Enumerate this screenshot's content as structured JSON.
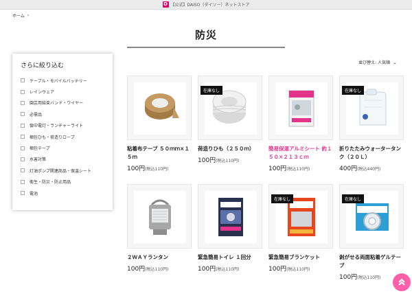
{
  "tab": {
    "favicon_text": "D",
    "title": "【公式】DAISO（ダイソー）ネットストア"
  },
  "breadcrumb": {
    "home": "ホーム",
    "separator": "›"
  },
  "page": {
    "title": "防災"
  },
  "filter": {
    "title": "さらに絞り込む",
    "items": [
      "ケーブル・モバイルバッテリー",
      "レインウェア",
      "園芸用結束バンド・ワイヤー",
      "必需品",
      "懐中電灯・ランチャーライト",
      "梱包ひも・荷造りロープ",
      "梱包テープ",
      "水害対策",
      "灯油ポンプ関連商品・保温シート",
      "衛生・防災・防止用品",
      "電池"
    ]
  },
  "sort": {
    "label": "並び替え: 人気順",
    "chevron": "⌄"
  },
  "colors": {
    "accent_pink": "#e4338b",
    "scroll_button": "#ff5fa8",
    "badge_bg": "#111111"
  },
  "products": [
    {
      "name": "粘着布テープ ５０ｍｍ×１５ｍ",
      "price": "100円",
      "tax": "(税込110円)",
      "badge": "",
      "icon": "packing-tape-icon",
      "highlight": false
    },
    {
      "name": "荷造りひも（２５０ｍ）",
      "price": "100円",
      "tax": "(税込110円)",
      "badge": "在庫なし",
      "icon": "twine-roll-icon",
      "highlight": false
    },
    {
      "name": "簡易保温アルミシート 約１５０×２１３ｃｍ",
      "price": "100円",
      "tax": "(税込110円)",
      "badge": "",
      "icon": "emergency-blanket-icon",
      "highlight": true
    },
    {
      "name": "折りたたみウォータータンク（２０Ｌ）",
      "price": "400円",
      "tax": "(税込440円)",
      "badge": "在庫なし",
      "icon": "water-tank-icon",
      "highlight": false
    },
    {
      "name": "２ＷＡＹランタン",
      "price": "100円",
      "tax": "(税込110円)",
      "badge": "",
      "icon": "lantern-icon",
      "highlight": false
    },
    {
      "name": "緊急簡易トイレ １回分",
      "price": "100円",
      "tax": "(税込110円)",
      "badge": "",
      "icon": "emergency-toilet-icon",
      "highlight": false
    },
    {
      "name": "緊急簡易ブランケット",
      "price": "100円",
      "tax": "(税込110円)",
      "badge": "在庫なし",
      "icon": "blanket-pack-icon",
      "highlight": false
    },
    {
      "name": "剥がせる両面粘着ゲルテープ",
      "price": "100円",
      "tax": "(税込110円)",
      "badge": "在庫なし",
      "icon": "gel-tape-icon",
      "highlight": false
    }
  ]
}
